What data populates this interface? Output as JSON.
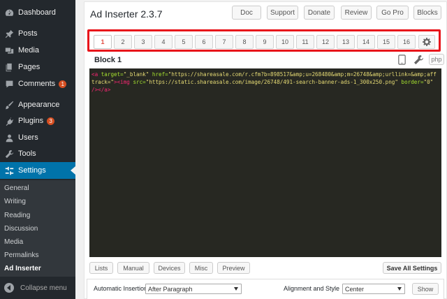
{
  "sidebar": {
    "items": [
      {
        "label": "Dashboard",
        "icon": "dashboard-icon"
      },
      {
        "label": "Posts",
        "icon": "pin-icon"
      },
      {
        "label": "Media",
        "icon": "media-icon"
      },
      {
        "label": "Pages",
        "icon": "pages-icon"
      },
      {
        "label": "Comments",
        "icon": "comment-icon",
        "badge": "1"
      },
      {
        "label": "Appearance",
        "icon": "brush-icon"
      },
      {
        "label": "Plugins",
        "icon": "plug-icon",
        "badge": "3"
      },
      {
        "label": "Users",
        "icon": "user-icon"
      },
      {
        "label": "Tools",
        "icon": "wrench-icon"
      },
      {
        "label": "Settings",
        "icon": "settings-icon",
        "active": true
      }
    ],
    "submenu": [
      "General",
      "Writing",
      "Reading",
      "Discussion",
      "Media",
      "Permalinks",
      "Ad Inserter"
    ],
    "submenu_current": "Ad Inserter",
    "collapse_label": "Collapse menu"
  },
  "header": {
    "title": "Ad Inserter 2.3.7",
    "buttons": [
      "Doc",
      "Support",
      "Donate",
      "Review",
      "Go Pro",
      "Blocks"
    ]
  },
  "tabs": {
    "labels": [
      "1",
      "2",
      "3",
      "4",
      "5",
      "6",
      "7",
      "8",
      "9",
      "10",
      "11",
      "12",
      "13",
      "14",
      "15",
      "16"
    ],
    "active": "1",
    "gear_icon": "gear-icon"
  },
  "block": {
    "title": "Block 1",
    "php_label": "php",
    "code": {
      "t1": "<a",
      "a1": " target=",
      "s1": "\"_blank\"",
      "a2": " href=",
      "s2": "\"https://shareasale.com/r.cfm?b=898517&amp;u=268480&amp;m=26748&amp;urllink=&amp;afftrack=\"",
      "p1": ">",
      "t2": "<img",
      "a3": " src=",
      "s3": "\"https://static.shareasale.com/image/26748/491-search-banner-ads-1_300x250.png\"",
      "a4": " border",
      "a5": "=",
      "s4": "\"0\"",
      "p2": " />",
      "t3": "</a>"
    }
  },
  "bottom": {
    "buttons": [
      "Lists",
      "Manual",
      "Devices",
      "Misc",
      "Preview"
    ],
    "save_label": "Save All Settings"
  },
  "settings": {
    "insertion_label": "Automatic Insertion",
    "insertion_value": "After Paragraph",
    "alignment_label": "Alignment and Style",
    "alignment_value": "Center",
    "show_label": "Show"
  },
  "colors": {
    "sidebar_bg": "#23282d",
    "active_blue": "#0073aa",
    "highlight_red": "#e8141a",
    "editor_bg": "#272822"
  }
}
